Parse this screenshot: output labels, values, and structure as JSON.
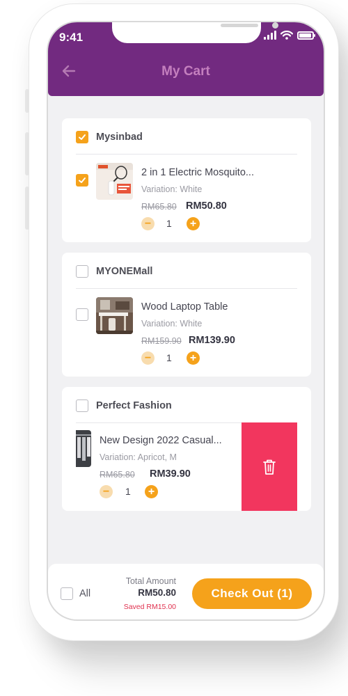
{
  "status_bar": {
    "time": "9:41"
  },
  "header": {
    "title": "My Cart"
  },
  "shops": [
    {
      "name": "Mysinbad",
      "selected": true,
      "item": {
        "name": "2 in 1 Electric Mosquito...",
        "variation": "Variation: White",
        "old_price": "RM65.80",
        "price": "RM50.80",
        "qty": "1",
        "selected": true
      }
    },
    {
      "name": "MYONEMall",
      "selected": false,
      "item": {
        "name": "Wood Laptop Table",
        "variation": "Variation: White",
        "old_price": "RM159.90",
        "price": "RM139.90",
        "qty": "1",
        "selected": false
      }
    },
    {
      "name": "Perfect Fashion",
      "selected": false,
      "item": {
        "name": "New Design 2022 Casual...",
        "variation": "Variation: Apricot, M",
        "old_price": "RM65.80",
        "price": "RM39.90",
        "qty": "1",
        "selected": false
      }
    }
  ],
  "footer": {
    "all_label": "All",
    "total_label": "Total Amount",
    "total_value": "RM50.80",
    "saved": "Saved RM15.00",
    "checkout_label": "Check Out (1)"
  },
  "colors": {
    "brand": "#722a80",
    "accent": "#f5a21b",
    "delete": "#f2365e"
  }
}
